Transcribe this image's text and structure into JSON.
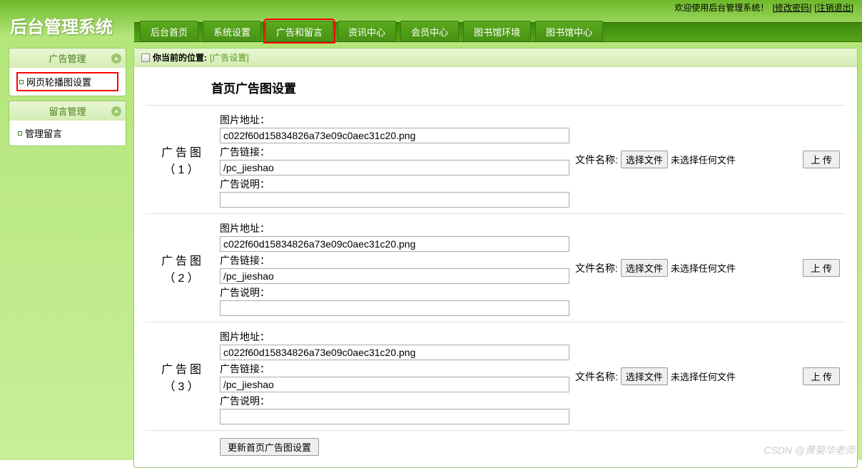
{
  "topbar": {
    "welcome": "欢迎使用后台管理系统！",
    "change_pw": "[修改密码]",
    "logout": "[注销退出]"
  },
  "logo": "后台管理系统",
  "nav": [
    "后台首页",
    "系统设置",
    "广告和留言",
    "资讯中心",
    "会员中心",
    "图书馆环境",
    "图书馆中心"
  ],
  "nav_highlight_index": 2,
  "sidebar": {
    "panels": [
      {
        "title": "广告管理",
        "items": [
          {
            "label": "网页轮播图设置",
            "highlight": true
          }
        ]
      },
      {
        "title": "留言管理",
        "items": [
          {
            "label": "管理留言",
            "highlight": false
          }
        ]
      }
    ]
  },
  "breadcrumb": {
    "prefix": "你当前的位置:",
    "location": "[广告设置]"
  },
  "page_title": "首页广告图设置",
  "field_labels": {
    "img_addr": "图片地址：",
    "ad_link": "广告链接：",
    "ad_desc": "广告说明："
  },
  "file_col": {
    "label": "文件名称:",
    "choose": "选择文件",
    "none": "未选择任何文件"
  },
  "upload_btn": "上 传",
  "ads": [
    {
      "row_label": "广告图（1）",
      "img_addr": "c022f60d15834826a73e09c0aec31c20.png",
      "ad_link": "/pc_jieshao",
      "ad_desc": ""
    },
    {
      "row_label": "广告图（2）",
      "img_addr": "c022f60d15834826a73e09c0aec31c20.png",
      "ad_link": "/pc_jieshao",
      "ad_desc": ""
    },
    {
      "row_label": "广告图（3）",
      "img_addr": "c022f60d15834826a73e09c0aec31c20.png",
      "ad_link": "/pc_jieshao",
      "ad_desc": ""
    }
  ],
  "submit_btn": "更新首页广告图设置",
  "watermark": "CSDN @黄菊华老师"
}
